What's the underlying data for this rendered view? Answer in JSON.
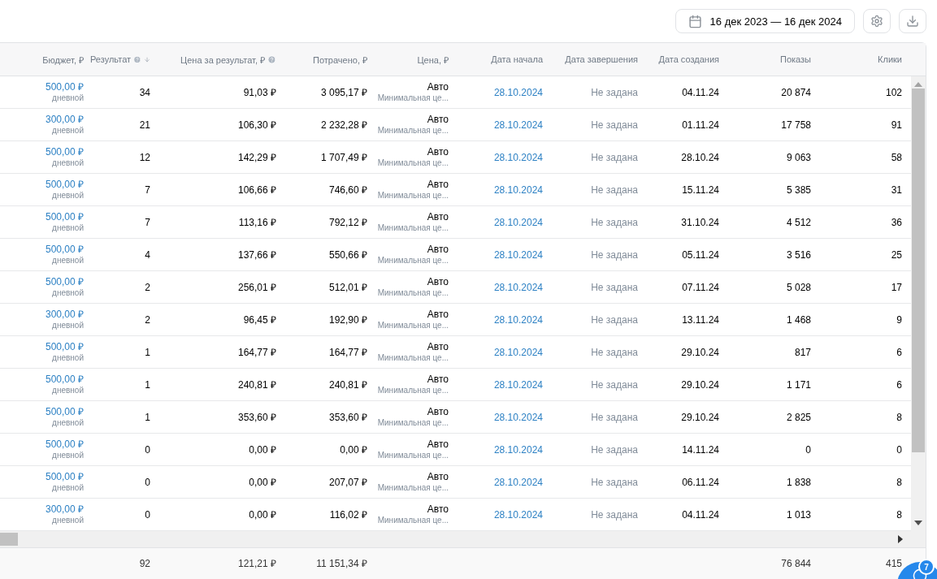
{
  "toolbar": {
    "date_range": "16 дек 2023 — 16 дек 2024"
  },
  "table": {
    "columns": [
      {
        "label": "Бюджет, ₽",
        "help": false,
        "sorted": false
      },
      {
        "label": "Результат",
        "help": true,
        "sorted": true
      },
      {
        "label": "Цена за результат, ₽",
        "help": true,
        "sorted": false
      },
      {
        "label": "Потрачено, ₽",
        "help": false,
        "sorted": false
      },
      {
        "label": "Цена, ₽",
        "help": false,
        "sorted": false
      },
      {
        "label": "Дата начала",
        "help": false,
        "sorted": false
      },
      {
        "label": "Дата завершения",
        "help": false,
        "sorted": false
      },
      {
        "label": "Дата создания",
        "help": false,
        "sorted": false
      },
      {
        "label": "Показы",
        "help": false,
        "sorted": false
      },
      {
        "label": "Клики",
        "help": false,
        "sorted": false
      }
    ],
    "rows": [
      {
        "budget": "500,00 ₽",
        "budget_type": "дневной",
        "result": "34",
        "cost_per_result": "91,03 ₽",
        "spent": "3 095,17 ₽",
        "price": "Авто",
        "price_note": "Минимальная це...",
        "start": "28.10.2024",
        "end": "Не задана",
        "created": "04.11.24",
        "impressions": "20 874",
        "clicks": "102"
      },
      {
        "budget": "300,00 ₽",
        "budget_type": "дневной",
        "result": "21",
        "cost_per_result": "106,30 ₽",
        "spent": "2 232,28 ₽",
        "price": "Авто",
        "price_note": "Минимальная це...",
        "start": "28.10.2024",
        "end": "Не задана",
        "created": "01.11.24",
        "impressions": "17 758",
        "clicks": "91"
      },
      {
        "budget": "500,00 ₽",
        "budget_type": "дневной",
        "result": "12",
        "cost_per_result": "142,29 ₽",
        "spent": "1 707,49 ₽",
        "price": "Авто",
        "price_note": "Минимальная це...",
        "start": "28.10.2024",
        "end": "Не задана",
        "created": "28.10.24",
        "impressions": "9 063",
        "clicks": "58"
      },
      {
        "budget": "500,00 ₽",
        "budget_type": "дневной",
        "result": "7",
        "cost_per_result": "106,66 ₽",
        "spent": "746,60 ₽",
        "price": "Авто",
        "price_note": "Минимальная це...",
        "start": "28.10.2024",
        "end": "Не задана",
        "created": "15.11.24",
        "impressions": "5 385",
        "clicks": "31"
      },
      {
        "budget": "500,00 ₽",
        "budget_type": "дневной",
        "result": "7",
        "cost_per_result": "113,16 ₽",
        "spent": "792,12 ₽",
        "price": "Авто",
        "price_note": "Минимальная це...",
        "start": "28.10.2024",
        "end": "Не задана",
        "created": "31.10.24",
        "impressions": "4 512",
        "clicks": "36"
      },
      {
        "budget": "500,00 ₽",
        "budget_type": "дневной",
        "result": "4",
        "cost_per_result": "137,66 ₽",
        "spent": "550,66 ₽",
        "price": "Авто",
        "price_note": "Минимальная це...",
        "start": "28.10.2024",
        "end": "Не задана",
        "created": "05.11.24",
        "impressions": "3 516",
        "clicks": "25"
      },
      {
        "budget": "500,00 ₽",
        "budget_type": "дневной",
        "result": "2",
        "cost_per_result": "256,01 ₽",
        "spent": "512,01 ₽",
        "price": "Авто",
        "price_note": "Минимальная це...",
        "start": "28.10.2024",
        "end": "Не задана",
        "created": "07.11.24",
        "impressions": "5 028",
        "clicks": "17"
      },
      {
        "budget": "300,00 ₽",
        "budget_type": "дневной",
        "result": "2",
        "cost_per_result": "96,45 ₽",
        "spent": "192,90 ₽",
        "price": "Авто",
        "price_note": "Минимальная це...",
        "start": "28.10.2024",
        "end": "Не задана",
        "created": "13.11.24",
        "impressions": "1 468",
        "clicks": "9"
      },
      {
        "budget": "500,00 ₽",
        "budget_type": "дневной",
        "result": "1",
        "cost_per_result": "164,77 ₽",
        "spent": "164,77 ₽",
        "price": "Авто",
        "price_note": "Минимальная це...",
        "start": "28.10.2024",
        "end": "Не задана",
        "created": "29.10.24",
        "impressions": "817",
        "clicks": "6"
      },
      {
        "budget": "500,00 ₽",
        "budget_type": "дневной",
        "result": "1",
        "cost_per_result": "240,81 ₽",
        "spent": "240,81 ₽",
        "price": "Авто",
        "price_note": "Минимальная це...",
        "start": "28.10.2024",
        "end": "Не задана",
        "created": "29.10.24",
        "impressions": "1 171",
        "clicks": "6"
      },
      {
        "budget": "500,00 ₽",
        "budget_type": "дневной",
        "result": "1",
        "cost_per_result": "353,60 ₽",
        "spent": "353,60 ₽",
        "price": "Авто",
        "price_note": "Минимальная це...",
        "start": "28.10.2024",
        "end": "Не задана",
        "created": "29.10.24",
        "impressions": "2 825",
        "clicks": "8"
      },
      {
        "budget": "500,00 ₽",
        "budget_type": "дневной",
        "result": "0",
        "cost_per_result": "0,00 ₽",
        "spent": "0,00 ₽",
        "price": "Авто",
        "price_note": "Минимальная це...",
        "start": "28.10.2024",
        "end": "Не задана",
        "created": "14.11.24",
        "impressions": "0",
        "clicks": "0"
      },
      {
        "budget": "500,00 ₽",
        "budget_type": "дневной",
        "result": "0",
        "cost_per_result": "0,00 ₽",
        "spent": "207,07 ₽",
        "price": "Авто",
        "price_note": "Минимальная це...",
        "start": "28.10.2024",
        "end": "Не задана",
        "created": "06.11.24",
        "impressions": "1 838",
        "clicks": "8"
      },
      {
        "budget": "300,00 ₽",
        "budget_type": "дневной",
        "result": "0",
        "cost_per_result": "0,00 ₽",
        "spent": "116,02 ₽",
        "price": "Авто",
        "price_note": "Минимальная це...",
        "start": "28.10.2024",
        "end": "Не задана",
        "created": "04.11.24",
        "impressions": "1 013",
        "clicks": "8"
      }
    ],
    "totals": {
      "result": "92",
      "cost_per_result": "121,21 ₽",
      "spent": "11 151,34 ₽",
      "impressions": "76 844",
      "clicks": "415"
    }
  },
  "chat_button": {
    "badge": "7"
  }
}
